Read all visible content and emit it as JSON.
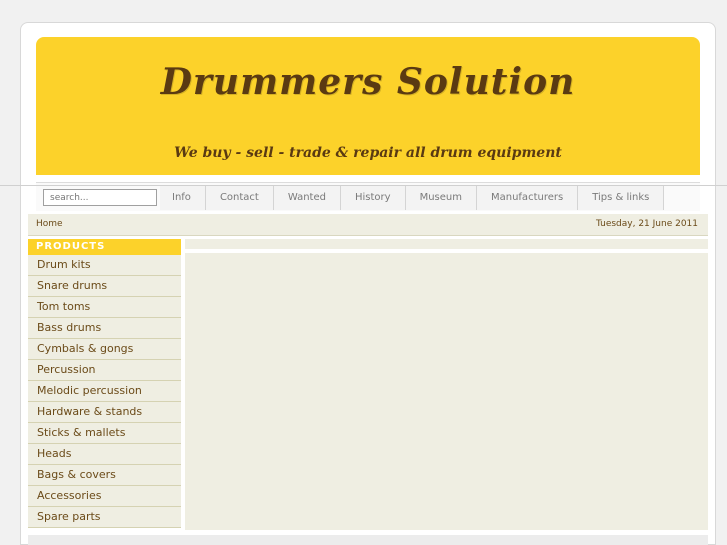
{
  "header": {
    "site_title": "Drummers Solution",
    "tagline": "We buy - sell - trade & repair all drum equipment"
  },
  "search": {
    "placeholder": "search..."
  },
  "nav": {
    "items": [
      "Info",
      "Contact",
      "Wanted",
      "History",
      "Museum",
      "Manufacturers",
      "Tips & links"
    ]
  },
  "breadcrumb": {
    "home": "Home"
  },
  "date": "Tuesday, 21 June 2011",
  "sidebar": {
    "header": "PRODUCTS",
    "items": [
      "Drum kits",
      "Snare drums",
      "Tom toms",
      "Bass drums",
      "Cymbals & gongs",
      "Percussion",
      "Melodic percussion",
      "Hardware & stands",
      "Sticks & mallets",
      "Heads",
      "Bags & covers",
      "Accessories",
      "Spare parts"
    ]
  },
  "colors": {
    "banner": "#fcd22a",
    "title_text": "#5a3a12",
    "panel": "#efeee2",
    "link_text": "#6b4b19"
  }
}
